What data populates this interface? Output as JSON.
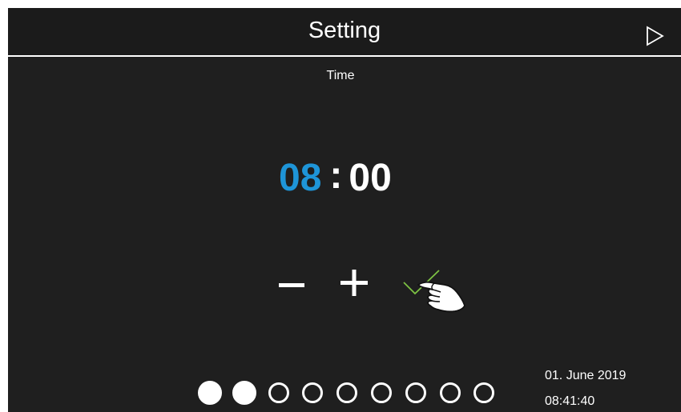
{
  "header": {
    "title": "Setting"
  },
  "section": {
    "label": "Time"
  },
  "time_edit": {
    "hours": "08",
    "separator": ":",
    "minutes": "00",
    "active_field": "hours",
    "active_color": "#1e95d8"
  },
  "controls": {
    "decrement_icon": "minus-icon",
    "increment_icon": "plus-icon",
    "confirm_icon": "checkmark-icon",
    "confirm_color": "#7dc243"
  },
  "pager": {
    "total": 9,
    "filled": [
      0,
      1
    ]
  },
  "status": {
    "date": "01. June 2019",
    "time": "08:41:40"
  },
  "colors": {
    "background": "#1f1f1f",
    "header_background": "#1b1b1b",
    "text": "#ffffff",
    "accent": "#1e95d8"
  }
}
